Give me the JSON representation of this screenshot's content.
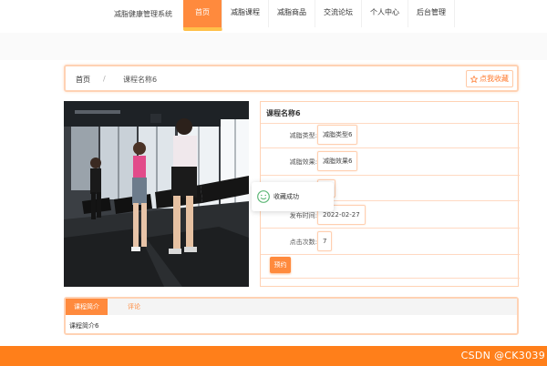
{
  "header": {
    "brand": "减脂健康管理系统",
    "nav": [
      {
        "label": "首页",
        "active": true
      },
      {
        "label": "减脂课程",
        "active": false
      },
      {
        "label": "减脂商品",
        "active": false
      },
      {
        "label": "交流论坛",
        "active": false
      },
      {
        "label": "个人中心",
        "active": false
      },
      {
        "label": "后台管理",
        "active": false
      }
    ]
  },
  "breadcrumb": {
    "home": "首页",
    "separator": "/",
    "current": "课程名称6",
    "favorite_label": "点我收藏"
  },
  "course": {
    "title": "课程名称6",
    "rows": [
      {
        "label": "减脂类型:",
        "value": "减脂类型6"
      },
      {
        "label": "减脂效果:",
        "value": "减脂效果6"
      },
      {
        "label": "",
        "value": ""
      },
      {
        "label": "发布时间:",
        "value": "2022-02-27"
      },
      {
        "label": "点击次数:",
        "value": "7"
      }
    ],
    "book_label": "预约"
  },
  "toast": {
    "text": "收藏成功"
  },
  "tabs": {
    "items": [
      "课程简介",
      "评论"
    ],
    "content": "课程简介6"
  },
  "watermark": "CSDN @CK3039",
  "colors": {
    "accent": "#ff8a3d",
    "accent_light": "#ffd2b4",
    "footer": "#ff7f1a"
  }
}
